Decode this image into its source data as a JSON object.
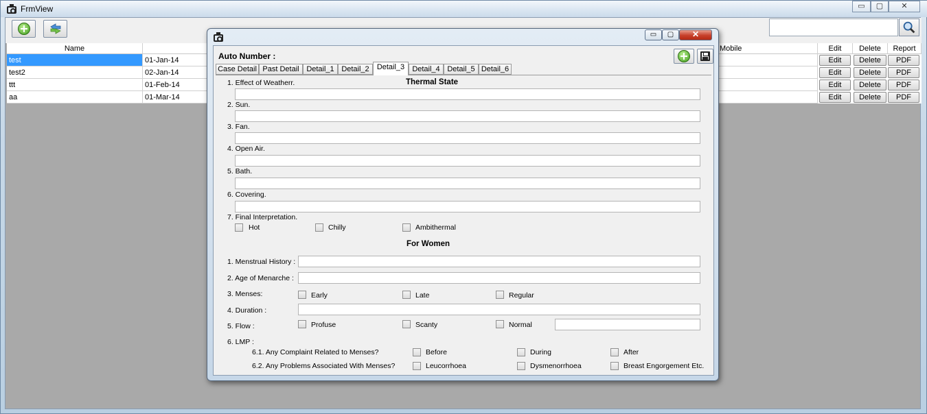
{
  "window": {
    "title": "FrmView",
    "min": "▭",
    "max": "▢",
    "close": "✕"
  },
  "search": {
    "value": ""
  },
  "grid": {
    "headers": [
      "Name",
      "Mobile",
      "Edit",
      "Delete",
      "Report"
    ],
    "rows": [
      {
        "name": "test",
        "date": "01-Jan-14",
        "edit": "Edit",
        "delete": "Delete",
        "report": "PDF"
      },
      {
        "name": "test2",
        "date": "02-Jan-14",
        "edit": "Edit",
        "delete": "Delete",
        "report": "PDF"
      },
      {
        "name": "ttt",
        "date": "01-Feb-14",
        "edit": "Edit",
        "delete": "Delete",
        "report": "PDF"
      },
      {
        "name": "aa",
        "date": "01-Mar-14",
        "edit": "Edit",
        "delete": "Delete",
        "report": "PDF"
      }
    ]
  },
  "dialog": {
    "auto_number_label": "Auto Number :",
    "min": "▭",
    "max": "▢",
    "close": "✕",
    "tabs": [
      "Case Detail",
      "Past Detail",
      "Detail_1",
      "Detail_2",
      "Detail_3",
      "Detail_4",
      "Detail_5",
      "Detail_6"
    ],
    "active_tab": "Detail_3",
    "thermal": {
      "heading": "Thermal State",
      "items": [
        "1. Effect of Weatherr.",
        "2. Sun.",
        "3. Fan.",
        "4. Open Air.",
        "5. Bath.",
        "6. Covering."
      ],
      "final_label": "7. Final Interpretation.",
      "final_options": [
        "Hot",
        "Chilly",
        "Ambithermal"
      ]
    },
    "women": {
      "heading": "For Women",
      "menstrual_history": "1. Menstrual History :",
      "age_menarche": "2. Age of Menarche :",
      "menses": "3. Menses:",
      "menses_options": [
        "Early",
        "Late",
        "Regular"
      ],
      "duration": "4. Duration :",
      "flow": "5. Flow :",
      "flow_options": [
        "Profuse",
        "Scanty",
        "Normal"
      ],
      "lmp": "6. LMP :",
      "complaint_label": "6.1.  Any Complaint Related to Menses?",
      "complaint_options": [
        "Before",
        "During",
        "After"
      ],
      "problems_label": "6.2.  Any Problems Associated With Menses?",
      "problems_options": [
        "Leucorrhoea",
        "Dysmenorrhoea",
        "Breast Engorgement Etc."
      ]
    }
  },
  "colors": {
    "selection": "#3399ff",
    "grid_bg": "#a9a9a9"
  }
}
